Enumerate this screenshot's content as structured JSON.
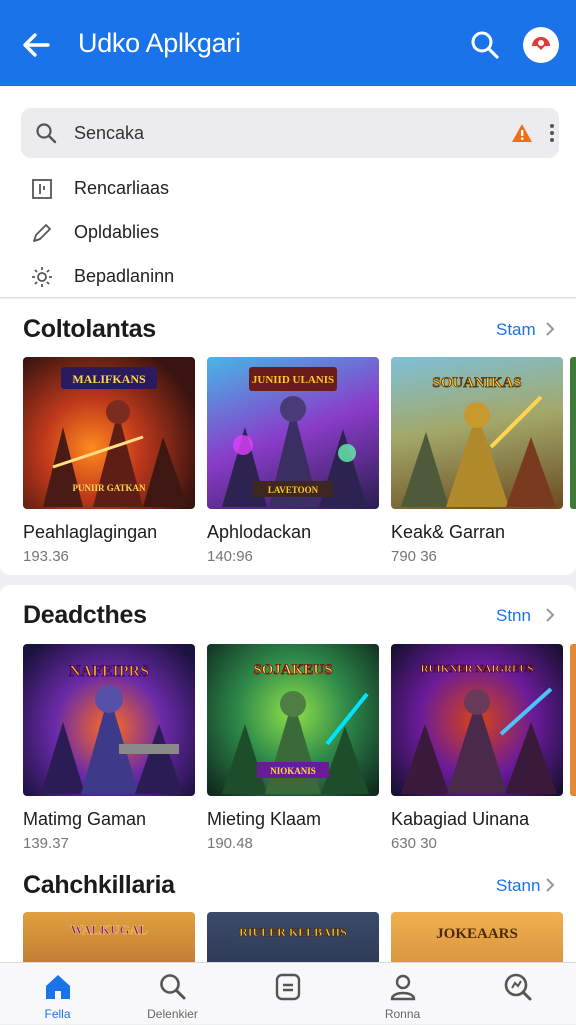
{
  "appbar": {
    "title": "Udko Aplkgari",
    "accent": "#1a73e8"
  },
  "search": {
    "value": "Sencaka"
  },
  "suggestions": [
    {
      "icon": "history-icon",
      "label": "Rencarliaas"
    },
    {
      "icon": "pencil-icon",
      "label": "Opldablies"
    },
    {
      "icon": "settings-icon",
      "label": "Bepadlaninn"
    }
  ],
  "sections": [
    {
      "title": "Coltolantas",
      "more": "Stam",
      "games": [
        {
          "name": "Peahlaglagingan",
          "meta": "193.36",
          "banner": "MALIFKANS",
          "sub": "PUNIIR GATKAN"
        },
        {
          "name": "Aphlodackan",
          "meta": "140:96",
          "banner": "JUNIID ULANIS",
          "sub": "LAVETOON"
        },
        {
          "name": "Keak& Garran",
          "meta": "790 36",
          "banner": "SOUANIKAS",
          "sub": ""
        }
      ]
    },
    {
      "title": "Deadcthes",
      "more": "Stnn",
      "games": [
        {
          "name": "Matimg Gaman",
          "meta": "139.37",
          "banner": "NAFEIPRS",
          "sub": ""
        },
        {
          "name": "Mieting Klaam",
          "meta": "190.48",
          "banner": "SOJAKEUS",
          "sub": "NIOKANIS"
        },
        {
          "name": "Kabagiad Uinana",
          "meta": "630 30",
          "banner": "RUIKNER NAIGREUS",
          "sub": ""
        }
      ]
    },
    {
      "title": "Cahchkillaria",
      "more": "Stann",
      "games": [
        {
          "banner": "WALKUGAL"
        },
        {
          "banner": "RIULER KELBAIIS"
        },
        {
          "banner": "JOKEAARS"
        }
      ]
    }
  ],
  "bottom_nav": [
    {
      "icon": "home-icon",
      "label": "Fella",
      "active": true
    },
    {
      "icon": "search-icon",
      "label": "Delenkier",
      "active": false
    },
    {
      "icon": "apps-icon",
      "label": "",
      "active": false
    },
    {
      "icon": "person-icon",
      "label": "Ronna",
      "active": false
    },
    {
      "icon": "search-chart-icon",
      "label": "",
      "active": false
    }
  ]
}
